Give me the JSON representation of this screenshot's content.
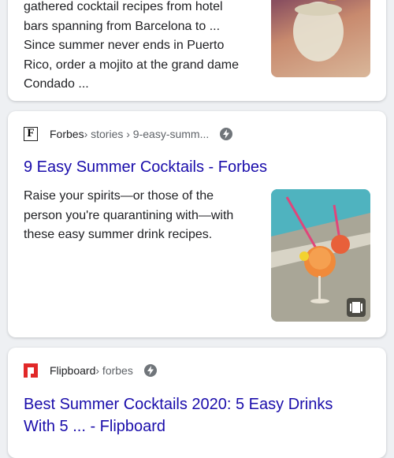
{
  "results": [
    {
      "snippet_lines": [
        "gathered cocktail recipes from hotel",
        "bars spanning from Barcelona to ...",
        "Since summer never ends in Puerto",
        "Rico, order a mojito at the grand dame",
        "Condado ..."
      ]
    },
    {
      "source": "Forbes",
      "favicon_letter": "F",
      "path": " › stories › 9-easy-summ...",
      "title": "9 Easy Summer Cocktails - Forbes",
      "snippet_lines": [
        "Raise your spirits—or those of the",
        "person you're quarantining with—with",
        "these easy summer drink recipes."
      ],
      "amp_icon": "lightning-bolt-icon",
      "thumbnail_badge_icon": "web-stories-icon"
    },
    {
      "source": "Flipboard",
      "path": " › forbes",
      "title_lines": [
        "Best Summer Cocktails 2020: 5 Easy Drinks",
        "With 5 ... - Flipboard"
      ],
      "amp_icon": "lightning-bolt-icon"
    }
  ],
  "colors": {
    "link": "#1a0dab",
    "text": "#202124",
    "secondary": "#5f6368",
    "background": "#eef0f3",
    "flipboard_red": "#e12828"
  }
}
